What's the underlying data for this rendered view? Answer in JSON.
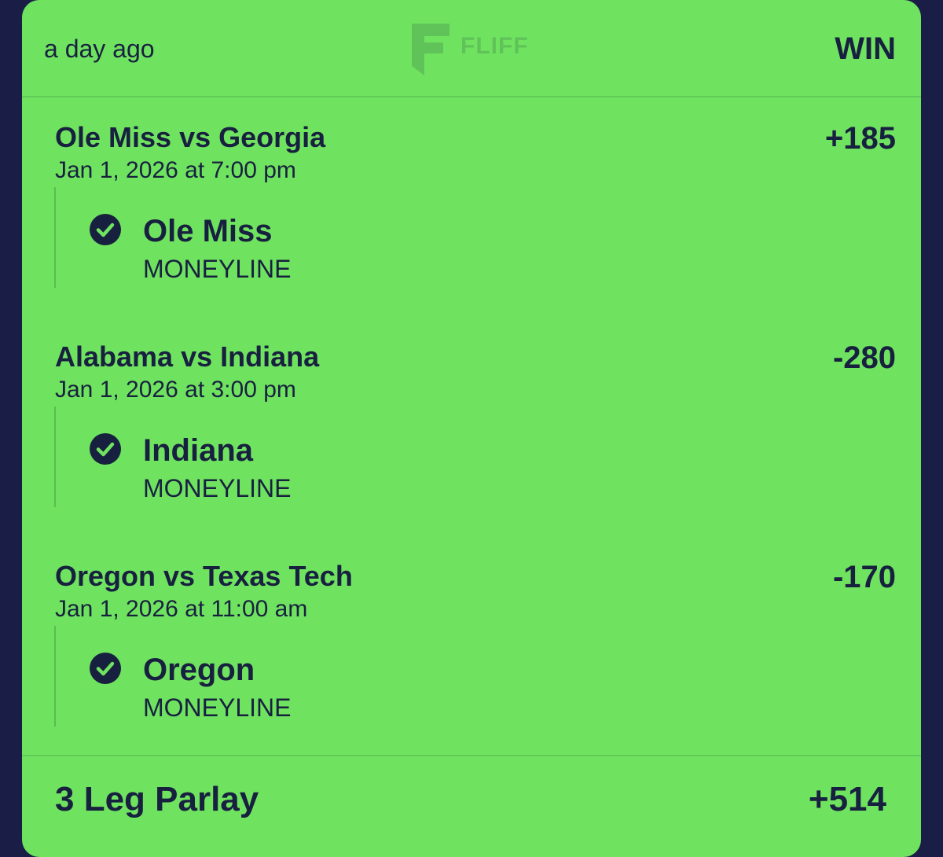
{
  "header": {
    "time_ago": "a day ago",
    "brand": "FLIFF",
    "status": "WIN"
  },
  "legs": [
    {
      "matchup": "Ole Miss vs Georgia",
      "game_time": "Jan 1, 2026 at 7:00 pm",
      "odds": "+185",
      "pick": "Ole Miss",
      "market": "MONEYLINE",
      "result_icon": "check-circle-icon"
    },
    {
      "matchup": "Alabama vs Indiana",
      "game_time": "Jan 1, 2026 at 3:00 pm",
      "odds": "-280",
      "pick": "Indiana",
      "market": "MONEYLINE",
      "result_icon": "check-circle-icon"
    },
    {
      "matchup": "Oregon vs Texas Tech",
      "game_time": "Jan 1, 2026 at 11:00 am",
      "odds": "-170",
      "pick": "Oregon",
      "market": "MONEYLINE",
      "result_icon": "check-circle-icon"
    }
  ],
  "footer": {
    "parlay_label": "3 Leg Parlay",
    "parlay_odds": "+514"
  },
  "colors": {
    "card_background": "#6fe35f",
    "page_background": "#1a1d45",
    "text": "#18203f"
  }
}
